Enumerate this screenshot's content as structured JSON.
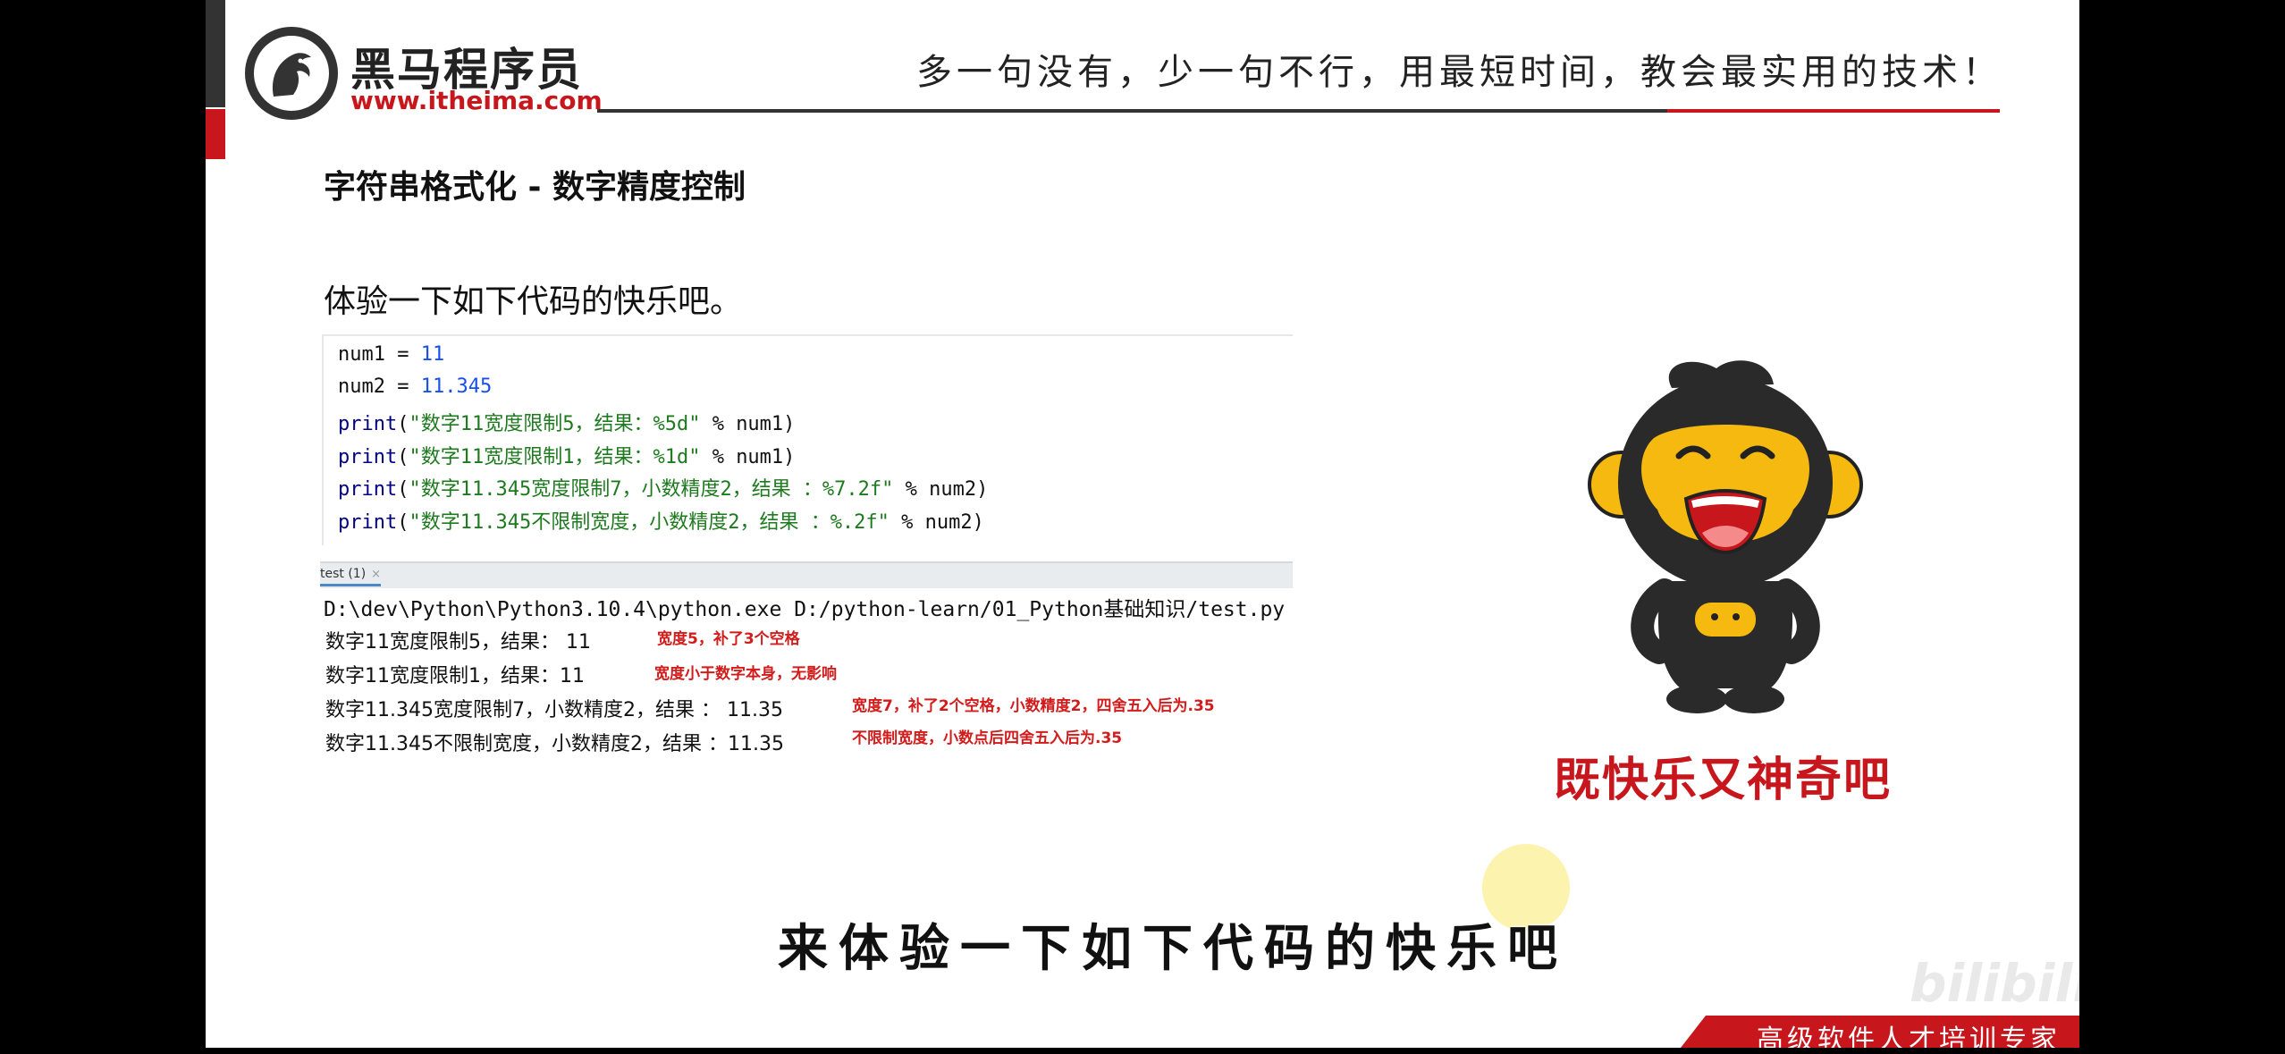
{
  "header": {
    "logo_cn": "黑马程序员",
    "logo_url": "www.itheima.com",
    "slogan": "多一句没有，少一句不行，用最短时间，教会最实用的技术！"
  },
  "slide": {
    "title": "字符串格式化 - 数字精度控制",
    "intro": "体验一下如下代码的快乐吧。"
  },
  "code": {
    "line1": {
      "var": "num1 = ",
      "num": "11"
    },
    "line2": {
      "var": "num2 = ",
      "num": "11.345"
    },
    "line3": {
      "kw": "print",
      "open": "(",
      "str": "\"数字11宽度限制5，结果：%5d\"",
      "rest": " % num1)"
    },
    "line4": {
      "kw": "print",
      "open": "(",
      "str": "\"数字11宽度限制1，结果：%1d\"",
      "rest": " % num1)"
    },
    "line5": {
      "kw": "print",
      "open": "(",
      "str": "\"数字11.345宽度限制7，小数精度2，结果 ：%7.2f\"",
      "rest": " % num2)"
    },
    "line6": {
      "kw": "print",
      "open": "(",
      "str": "\"数字11.345不限制宽度，小数精度2，结果 ：%.2f\"",
      "rest": " % num2)"
    }
  },
  "run": {
    "tab_label": "test (1)",
    "tab_close": "×",
    "command": "D:\\dev\\Python\\Python3.10.4\\python.exe D:/python-learn/01_Python基础知识/test.py",
    "outputs": [
      {
        "text": "数字11宽度限制5，结果：    11",
        "note": "宽度5，补了3个空格"
      },
      {
        "text": "数字11宽度限制1，结果：11",
        "note": "宽度小于数字本身，无影响"
      },
      {
        "text": "数字11.345宽度限制7，小数精度2，结果 ：  11.35",
        "note": "宽度7，补了2个空格，小数精度2，四舍五入后为.35"
      },
      {
        "text": "数字11.345不限制宽度，小数精度2，结果 ：11.35",
        "note": "不限制宽度，小数点后四舍五入后为.35"
      }
    ]
  },
  "mascot": {
    "caption": "既快乐又神奇吧"
  },
  "subtitle": "来体验一下如下代码的快乐吧",
  "watermark": "bilibili",
  "footer": {
    "text": "高级软件人才培训专家"
  },
  "colors": {
    "brand_red": "#c8161d",
    "dark": "#333333",
    "mascot_yellow": "#f5b90f"
  }
}
